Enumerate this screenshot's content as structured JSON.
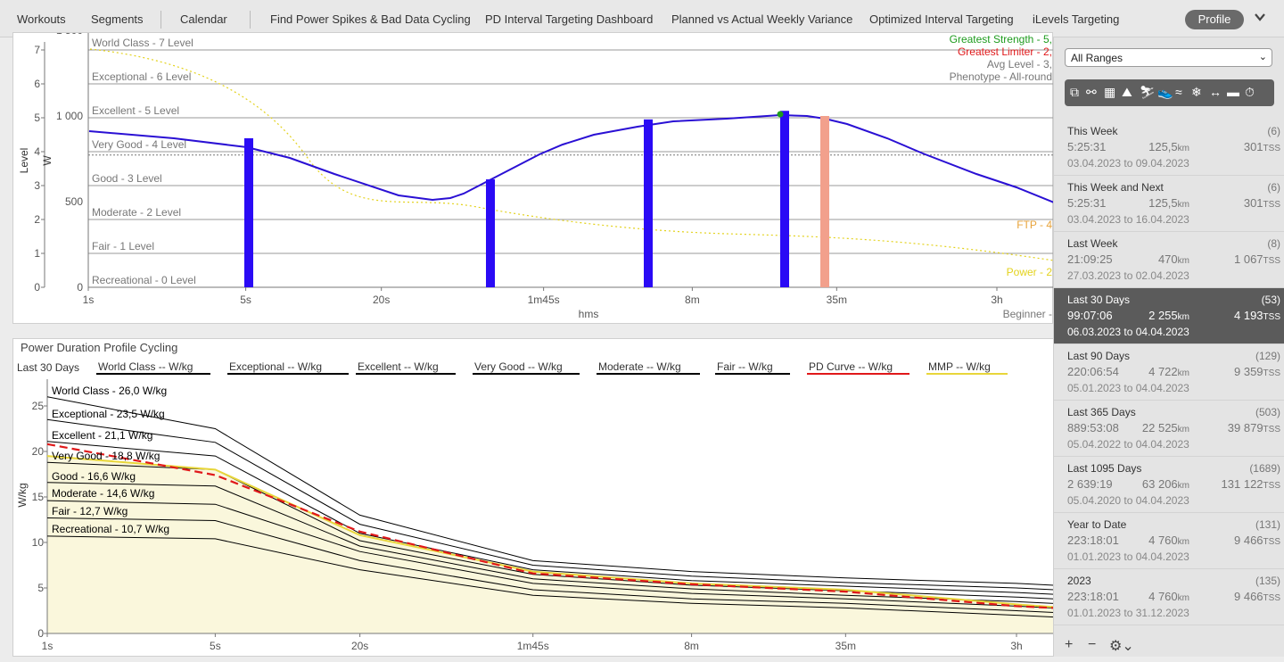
{
  "tabs": [
    "Workouts",
    "Segments",
    "Calendar",
    "Find Power Spikes & Bad Data Cycling",
    "PD Interval Targeting Dashboard",
    "Planned vs Actual Weekly Variance",
    "Optimized Interval Targeting",
    "iLevels Targeting"
  ],
  "profile_label": "Profile",
  "top_chart": {
    "levels": [
      "World Class - 7 Level",
      "Exceptional - 6 Level",
      "Excellent - 5 Level",
      "Very Good - 4 Level",
      "Good - 3 Level",
      "Moderate - 2 Level",
      "Fair - 1 Level",
      "Recreational - 0 Level"
    ],
    "y_level_ticks": [
      "7",
      "6",
      "5",
      "4",
      "3",
      "2",
      "1",
      "0"
    ],
    "y_watt_ticks": [
      "1 500",
      "1 000",
      "500",
      "0"
    ],
    "y_level_label": "Level",
    "y_watt_label": "W",
    "x_ticks": [
      "1s",
      "5s",
      "20s",
      "1m45s",
      "8m",
      "35m",
      "3h"
    ],
    "x_label": "hms",
    "info_strength": "Greatest Strength - 5,",
    "info_limiter": "Greatest Limiter - 2,",
    "info_avg": "Avg Level - 3,",
    "info_phenotype": "Phenotype - All-round",
    "ftp_label": "FTP - 4",
    "power_label": "Power - 2",
    "beginner_label": "Beginner -",
    "colors": {
      "curve": "#2a10d4",
      "bar": "#2a0af5",
      "limiter_bar": "#f2a08c",
      "strength": "#1e9c1e",
      "limiter": "#e0181a",
      "ftp": "#e8a33a",
      "power": "#e3d21c"
    }
  },
  "bottom_chart": {
    "title": "Power Duration Profile Cycling",
    "range_label": "Last 30 Days",
    "legend": [
      "World Class  -- W/kg",
      "Exceptional  -- W/kg",
      "Excellent  -- W/kg",
      "Very Good  -- W/kg",
      "Moderate  -- W/kg",
      "Fair  -- W/kg",
      "PD Curve  -- W/kg",
      "MMP  -- W/kg"
    ],
    "level_labels": [
      "World Class - 26,0 W/kg",
      "Exceptional - 23,5 W/kg",
      "Excellent - 21,1 W/kg",
      "Very Good - 18,8 W/kg",
      "Good - 16,6 W/kg",
      "Moderate - 14,6 W/kg",
      "Fair - 12,7 W/kg",
      "Recreational - 10,7 W/kg"
    ],
    "y_label": "W/kg",
    "y_ticks": [
      "25",
      "20",
      "15",
      "10",
      "5",
      "0"
    ],
    "x_ticks": [
      "1s",
      "5s",
      "20s",
      "1m45s",
      "8m",
      "35m",
      "3h"
    ],
    "colors": {
      "pd_curve": "#e0181a",
      "mmp": "#e8d63a",
      "fill": "#faf7dc"
    }
  },
  "chart_data": [
    {
      "type": "line",
      "title": "",
      "xlabel": "hms",
      "ylabel": "W",
      "ylim": [
        0,
        1650
      ],
      "x": [
        "1s",
        "5s",
        "20s",
        "1m45s",
        "8m",
        "35m",
        "3h"
      ],
      "series": [
        {
          "values": [
            930,
            870,
            620,
            880,
            1000,
            1010,
            560
          ]
        }
      ],
      "bars": [
        {
          "x": "5s",
          "value": 870
        },
        {
          "x": "1m",
          "value": 630
        },
        {
          "x": "6m",
          "value": 980
        },
        {
          "x": "25m",
          "value": 1030
        },
        {
          "x": "33m",
          "value": 1000
        }
      ]
    },
    {
      "type": "line",
      "title": "Power Duration Profile Cycling",
      "xlabel": "",
      "ylabel": "W/kg",
      "ylim": [
        0,
        28
      ],
      "x": [
        "1s",
        "5s",
        "20s",
        "1m45s",
        "8m",
        "35m",
        "3h"
      ],
      "series": [
        {
          "name": "World Class  -- W/kg",
          "values": [
            26.0,
            22.5,
            13.0,
            8.0,
            6.8,
            6.1,
            5.5
          ]
        },
        {
          "name": "Exceptional  -- W/kg",
          "values": [
            23.5,
            21.0,
            12.0,
            7.5,
            6.3,
            5.6,
            5.0
          ]
        },
        {
          "name": "Excellent  -- W/kg",
          "values": [
            21.1,
            19.5,
            11.0,
            7.0,
            5.8,
            5.2,
            4.5
          ]
        },
        {
          "name": "Very Good  -- W/kg",
          "values": [
            18.8,
            18.0,
            10.2,
            6.5,
            5.3,
            4.7,
            4.0
          ]
        },
        {
          "name": "Moderate  -- W/kg",
          "values": [
            14.6,
            14.2,
            9.0,
            5.5,
            4.4,
            3.8,
            3.0
          ]
        },
        {
          "name": "Fair  -- W/kg",
          "values": [
            12.7,
            12.4,
            8.0,
            4.8,
            3.8,
            3.3,
            2.5
          ]
        },
        {
          "name": "PD Curve  -- W/kg",
          "values": [
            20.8,
            17.4,
            11.2,
            6.6,
            5.4,
            4.6,
            3.0
          ]
        },
        {
          "name": "MMP  -- W/kg",
          "values": [
            19.5,
            18.0,
            10.8,
            6.8,
            5.5,
            4.8,
            3.2
          ]
        }
      ]
    }
  ],
  "sidebar": {
    "select_value": "All Ranges",
    "ranges": [
      {
        "name": "This Week",
        "count": "(6)",
        "time": "5:25:31",
        "dist": "125,5",
        "tss": "301",
        "dates": "03.04.2023 to 09.04.2023",
        "selected": false
      },
      {
        "name": "This Week and Next",
        "count": "(6)",
        "time": "5:25:31",
        "dist": "125,5",
        "tss": "301",
        "dates": "03.04.2023 to 16.04.2023",
        "selected": false
      },
      {
        "name": "Last Week",
        "count": "(8)",
        "time": "21:09:25",
        "dist": "470",
        "tss": "1 067",
        "dates": "27.03.2023 to 02.04.2023",
        "selected": false
      },
      {
        "name": "Last 30 Days",
        "count": "(53)",
        "time": "99:07:06",
        "dist": "2 255",
        "tss": "4 193",
        "dates": "06.03.2023 to 04.04.2023",
        "selected": true
      },
      {
        "name": "Last 90 Days",
        "count": "(129)",
        "time": "220:06:54",
        "dist": "4 722",
        "tss": "9 359",
        "dates": "05.01.2023 to 04.04.2023",
        "selected": false
      },
      {
        "name": "Last 365 Days",
        "count": "(503)",
        "time": "889:53:08",
        "dist": "22 525",
        "tss": "39 879",
        "dates": "05.04.2022 to 04.04.2023",
        "selected": false
      },
      {
        "name": "Last 1095 Days",
        "count": "(1689)",
        "time": "2 639:19",
        "dist": "63 206",
        "tss": "131 122",
        "dates": "05.04.2020 to 04.04.2023",
        "selected": false
      },
      {
        "name": "Year to Date",
        "count": "(131)",
        "time": "223:18:01",
        "dist": "4 760",
        "tss": "9 466",
        "dates": "01.01.2023 to 04.04.2023",
        "selected": false
      },
      {
        "name": "2023",
        "count": "(135)",
        "time": "223:18:01",
        "dist": "4 760",
        "tss": "9 466",
        "dates": "01.01.2023 to 31.12.2023",
        "selected": false
      }
    ],
    "km_unit": "km",
    "tss_unit": "TSS"
  }
}
